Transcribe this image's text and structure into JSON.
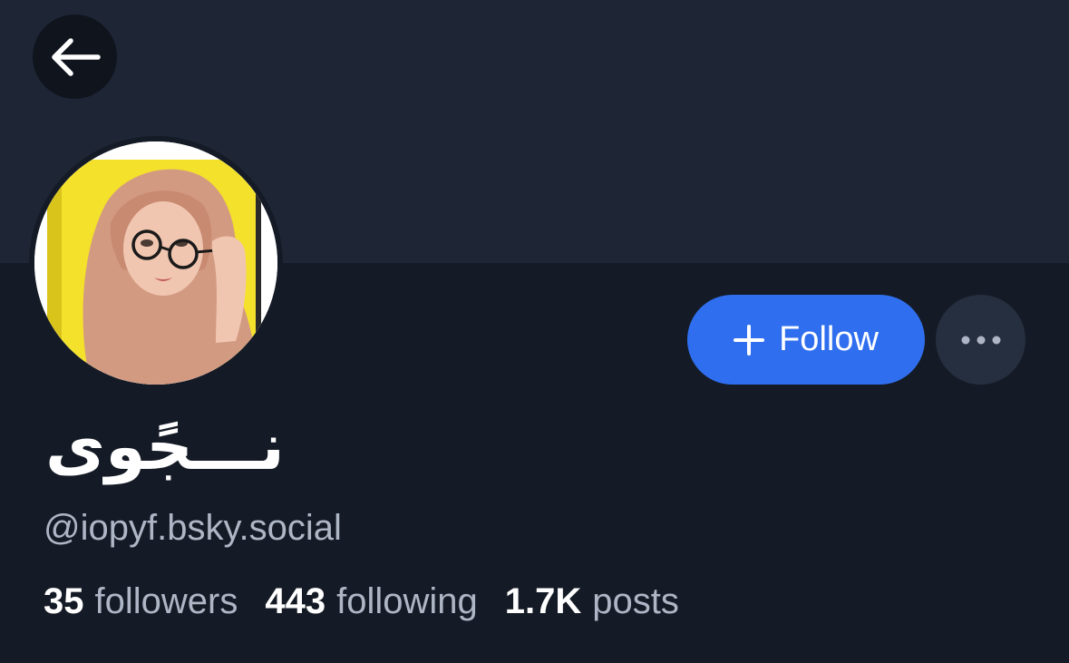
{
  "profile": {
    "display_name": "نـــجًوى",
    "handle": "@iopyf.bsky.social"
  },
  "actions": {
    "follow_label": "Follow"
  },
  "stats": {
    "followers_count": "35",
    "followers_label": "followers",
    "following_count": "443",
    "following_label": "following",
    "posts_count": "1.7K",
    "posts_label": "posts"
  },
  "icons": {
    "back": "arrow-left-icon",
    "follow": "plus-icon",
    "more": "ellipsis-icon"
  },
  "colors": {
    "background": "#151b26",
    "banner": "#1e2636",
    "accent": "#2f6fef",
    "muted_text": "#aeb6c6"
  }
}
